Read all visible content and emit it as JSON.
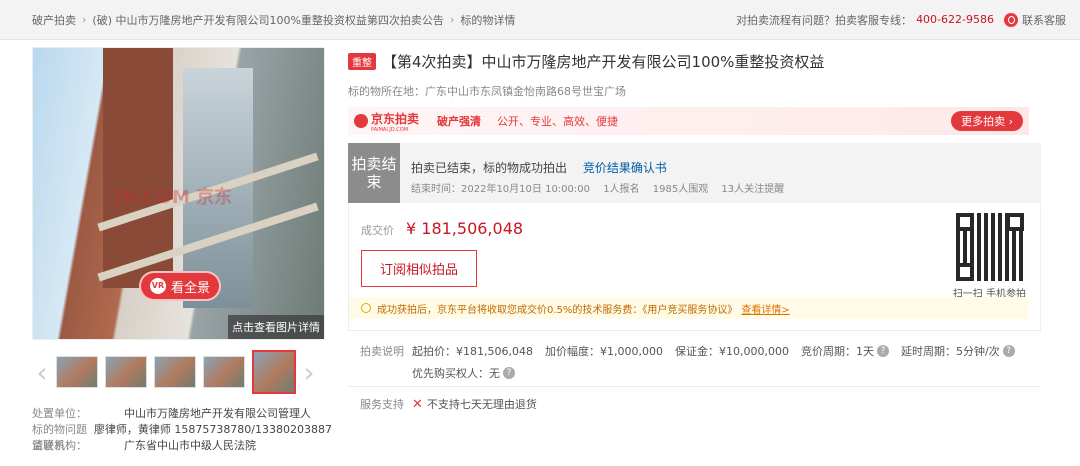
{
  "breadcrumb": [
    "破产拍卖",
    "(破) 中山市万隆房地产开发有限公司100%重整投资权益第四次拍卖公告",
    "标的物详情"
  ],
  "top_help": {
    "question": "对拍卖流程有问题？拍卖客服专线：",
    "phone": "400-622-9586",
    "contact": "联系客服"
  },
  "gallery": {
    "watermark": "JD.COM 京东",
    "pano_label": "看全景",
    "pano_icon": "VR",
    "detail_label": "点击查看图片详情"
  },
  "item": {
    "tag": "重整",
    "title": "【第4次拍卖】中山市万隆房地产开发有限公司100%重整投资权益",
    "location_label": "标的物所在地：",
    "location": "广东中山市东凤镇金怡南路68号世宝广场"
  },
  "banner": {
    "logo": "京东拍卖",
    "logo_sub": "PAIMAI.JD.COM",
    "slogan1": "破产强清",
    "slogan2": "公开、专业、高效、便捷",
    "more": "更多拍卖 ›"
  },
  "status": {
    "label": "拍卖结束",
    "main": "拍卖已结束，标的物成功拍出",
    "link": "竞价结果确认书",
    "end_time": "结束时间：2022年10月10日 10:00:00",
    "bidders": "1人报名",
    "views": "1985人围观",
    "watchers": "13人关注提醒"
  },
  "price": {
    "label": "成交价",
    "value": "¥ 181,506,048",
    "subscribe": "订阅相似拍品",
    "qr_caption": "扫一扫 手机参拍"
  },
  "notice": {
    "text": "成功获拍后，京东平台将收取您成交价0.5%的技术服务费：《用户竞买服务协议》",
    "link": "查看详情>"
  },
  "rules": {
    "label": "拍卖说明",
    "start_price": "起拍价：¥181,506,048",
    "increment": "加价幅度：¥1,000,000",
    "deposit": "保证金：¥10,000,000",
    "cycle": "竞价周期：1天",
    "delay": "延时周期：5分钟/次",
    "priority": "优先购买权人：无"
  },
  "service": {
    "label": "服务支持",
    "value": "不支持七天无理由退货"
  },
  "meta": [
    {
      "k": "处置单位：",
      "v": "中山市万隆房地产开发有限公司管理人"
    },
    {
      "k": "标的物问题请联系：",
      "v": "廖律师，黄律师 15875738780/13380203887"
    },
    {
      "k": "监管机构：",
      "v": "广东省中山市中级人民法院"
    }
  ]
}
